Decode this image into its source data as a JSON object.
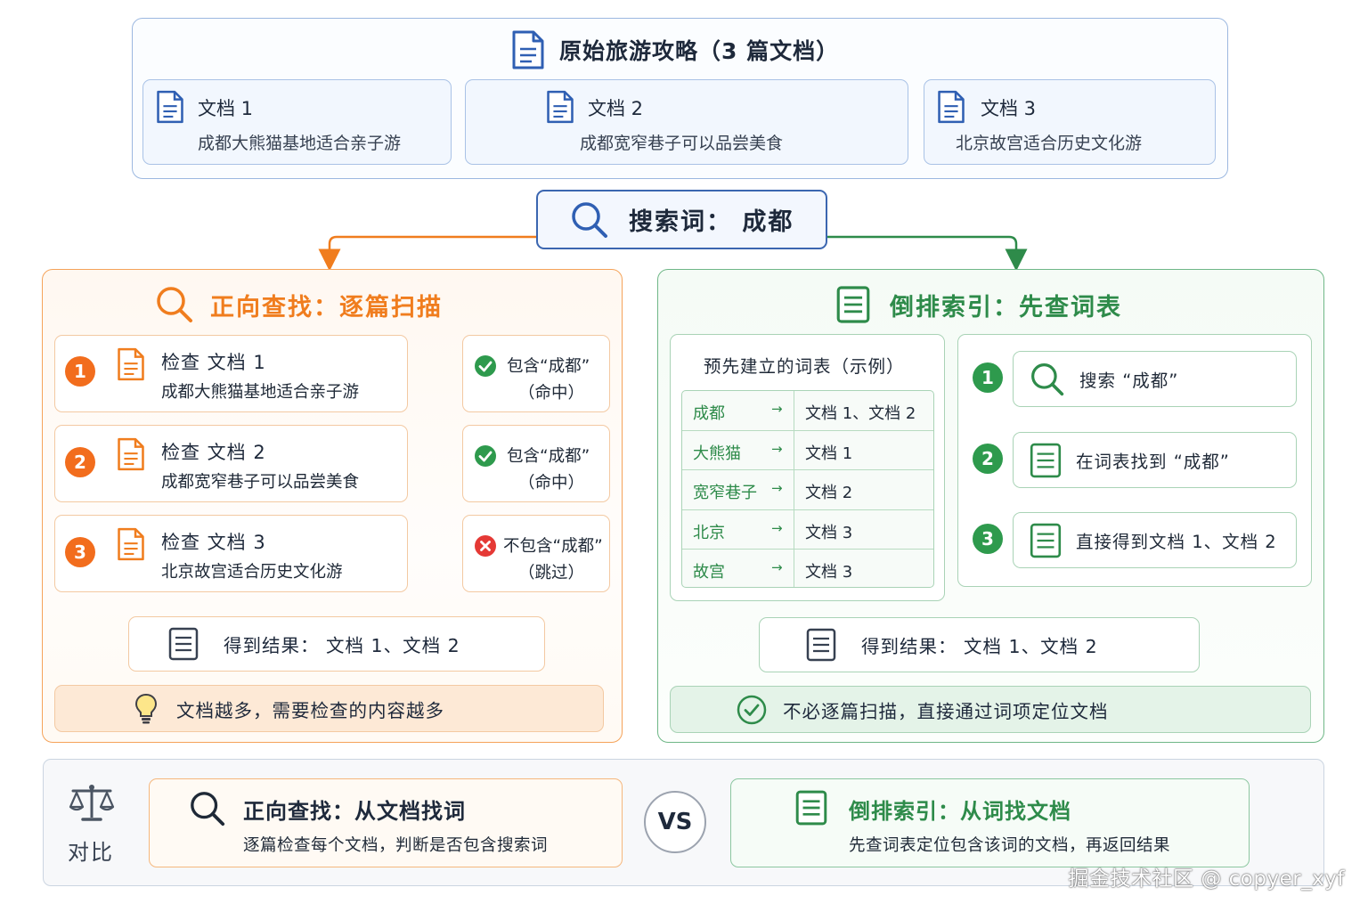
{
  "colors": {
    "blue": "#3b66b0",
    "orange": "#f07d1e",
    "green": "#2e8b4a",
    "red": "#e53935"
  },
  "top": {
    "title": "原始旅游攻略（3 篇文档）",
    "docs": [
      {
        "name": "文档 1",
        "desc": "成都大熊猫基地适合亲子游"
      },
      {
        "name": "文档 2",
        "desc": "成都宽窄巷子可以品尝美食"
      },
      {
        "name": "文档 3",
        "desc": "北京故宫适合历史文化游"
      }
    ]
  },
  "search": {
    "label": "搜索词：  成都"
  },
  "forward": {
    "title": "正向查找：逐篇扫描",
    "checks": [
      {
        "num": "1",
        "title": "检查 文档 1",
        "desc": "成都大熊猫基地适合亲子游",
        "result": "包含“成都”",
        "status": "（命中）",
        "hit": true
      },
      {
        "num": "2",
        "title": "检查 文档 2",
        "desc": "成都宽窄巷子可以品尝美食",
        "result": "包含“成都”",
        "status": "（命中）",
        "hit": true
      },
      {
        "num": "3",
        "title": "检查 文档 3",
        "desc": "北京故宫适合历史文化游",
        "result": "不包含“成都”",
        "status": "（跳过）",
        "hit": false
      }
    ],
    "result": "得到结果：  文档 1、文档 2",
    "tip": "文档越多，需要检查的内容越多"
  },
  "inverted": {
    "title": "倒排索引：先查词表",
    "dict_title": "预先建立的词表（示例）",
    "dict": [
      {
        "term": "成都",
        "arrow": "→",
        "docs": "文档 1、文档 2"
      },
      {
        "term": "大熊猫",
        "arrow": "→",
        "docs": "文档 1"
      },
      {
        "term": "宽窄巷子",
        "arrow": "→",
        "docs": "文档 2"
      },
      {
        "term": "北京",
        "arrow": "→",
        "docs": "文档 3"
      },
      {
        "term": "故宫",
        "arrow": "→",
        "docs": "文档 3"
      }
    ],
    "steps": [
      {
        "num": "1",
        "text": "搜索 “成都”"
      },
      {
        "num": "2",
        "text": "在词表找到 “成都”"
      },
      {
        "num": "3",
        "text": "直接得到文档 1、文档 2"
      }
    ],
    "result": "得到结果：  文档 1、文档 2",
    "tip": "不必逐篇扫描，直接通过词项定位文档"
  },
  "compare": {
    "label": "对比",
    "vs": "VS",
    "left": {
      "title": "正向查找：从文档找词",
      "desc": "逐篇检查每个文档，判断是否包含搜索词"
    },
    "right": {
      "title": "倒排索引：从词找文档",
      "desc": "先查词表定位包含该词的文档，再返回结果"
    }
  },
  "watermark": "掘金技术社区 @ copyer_xyf"
}
